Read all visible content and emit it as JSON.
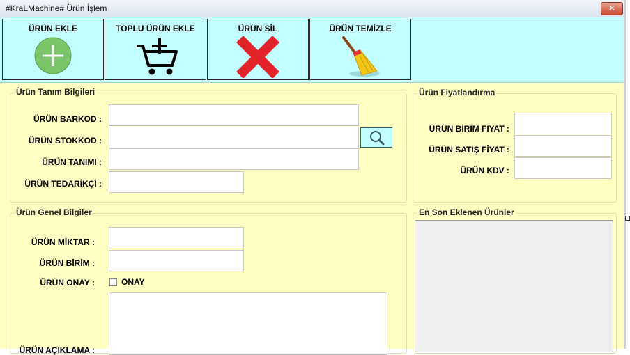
{
  "window": {
    "title": "#KraLMachine#  Ürün İşlem",
    "close_glyph": "✕"
  },
  "toolbar": {
    "add": {
      "label": "ÜRÜN EKLE",
      "icon": "plus-circle-icon"
    },
    "bulk_add": {
      "label": "TOPLU ÜRÜN EKLE",
      "icon": "cart-plus-icon"
    },
    "delete": {
      "label": "ÜRÜN SİL",
      "icon": "red-x-icon"
    },
    "clear": {
      "label": "ÜRÜN TEMİZLE",
      "icon": "broom-icon"
    }
  },
  "definition": {
    "title": "Ürün Tanım Bilgileri",
    "barcode_label": "ÜRÜN BARKOD :",
    "stockcode_label": "ÜRÜN STOKKOD :",
    "name_label": "ÜRÜN TANIMI :",
    "supplier_label": "ÜRÜN TEDARİKÇİ :"
  },
  "pricing": {
    "title": "Ürün Fiyatlandırma",
    "unit_price_label": "ÜRÜN BİRİM FİYAT :",
    "sale_price_label": "ÜRÜN SATIŞ FİYAT :",
    "vat_label": "ÜRÜN KDV :"
  },
  "general": {
    "title": "Ürün Genel Bilgiler",
    "quantity_label": "ÜRÜN MİKTAR :",
    "unit_label": "ÜRÜN BİRİM :",
    "approval_label": "ÜRÜN ONAY :",
    "approval_checkbox_label": "ONAY",
    "description_label": "ÜRÜN AÇIKLAMA :"
  },
  "recent": {
    "title": "En Son Eklenen Ürünler"
  },
  "colors": {
    "toolbar_bg": "#c4ffff",
    "form_bg": "#ffffc4"
  }
}
